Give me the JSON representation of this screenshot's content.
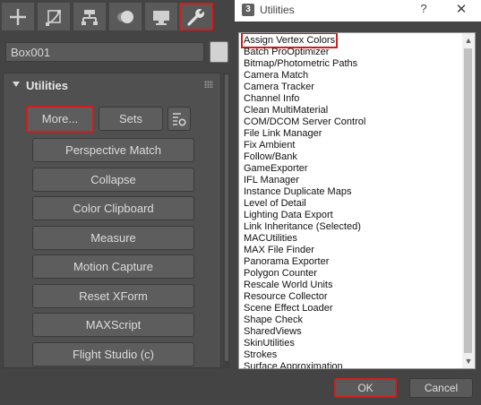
{
  "command_panel": {
    "tabs": [
      {
        "icon": "plus-icon",
        "name": "Create"
      },
      {
        "icon": "modify-icon",
        "name": "Modify"
      },
      {
        "icon": "hierarchy-icon",
        "name": "Hierarchy"
      },
      {
        "icon": "motion-icon",
        "name": "Motion"
      },
      {
        "icon": "display-icon",
        "name": "Display"
      },
      {
        "icon": "wrench-icon",
        "name": "Utilities",
        "active": true
      }
    ],
    "object_name": "Box001",
    "object_color": "#d2d2d2",
    "rollout": {
      "title": "Utilities",
      "more_label": "More...",
      "sets_label": "Sets",
      "utility_buttons": [
        "Perspective Match",
        "Collapse",
        "Color Clipboard",
        "Measure",
        "Motion Capture",
        "Reset XForm",
        "MAXScript",
        "Flight Studio (c)"
      ]
    }
  },
  "dialog": {
    "app_icon": "3",
    "title": "Utilities",
    "help": "?",
    "close": "✕",
    "items": [
      "Assign Vertex Colors",
      "Batch ProOptimizer",
      "Bitmap/Photometric Paths",
      "Camera Match",
      "Camera Tracker",
      "Channel Info",
      "Clean MultiMaterial",
      "COM/DCOM Server Control",
      "File Link Manager",
      "Fix Ambient",
      "Follow/Bank",
      "GameExporter",
      "IFL Manager",
      "Instance Duplicate Maps",
      "Level of Detail",
      "Lighting Data Export",
      "Link Inheritance (Selected)",
      "MACUtilities",
      "MAX File Finder",
      "Panorama Exporter",
      "Polygon Counter",
      "Rescale World Units",
      "Resource Collector",
      "Scene Effect Loader",
      "Shape Check",
      "SharedViews",
      "SkinUtilities",
      "Strokes",
      "Surface Approximation"
    ],
    "selected_index": 0,
    "ok_label": "OK",
    "cancel_label": "Cancel"
  },
  "colors": {
    "highlight": "#d21d1d",
    "panel": "#444444"
  }
}
